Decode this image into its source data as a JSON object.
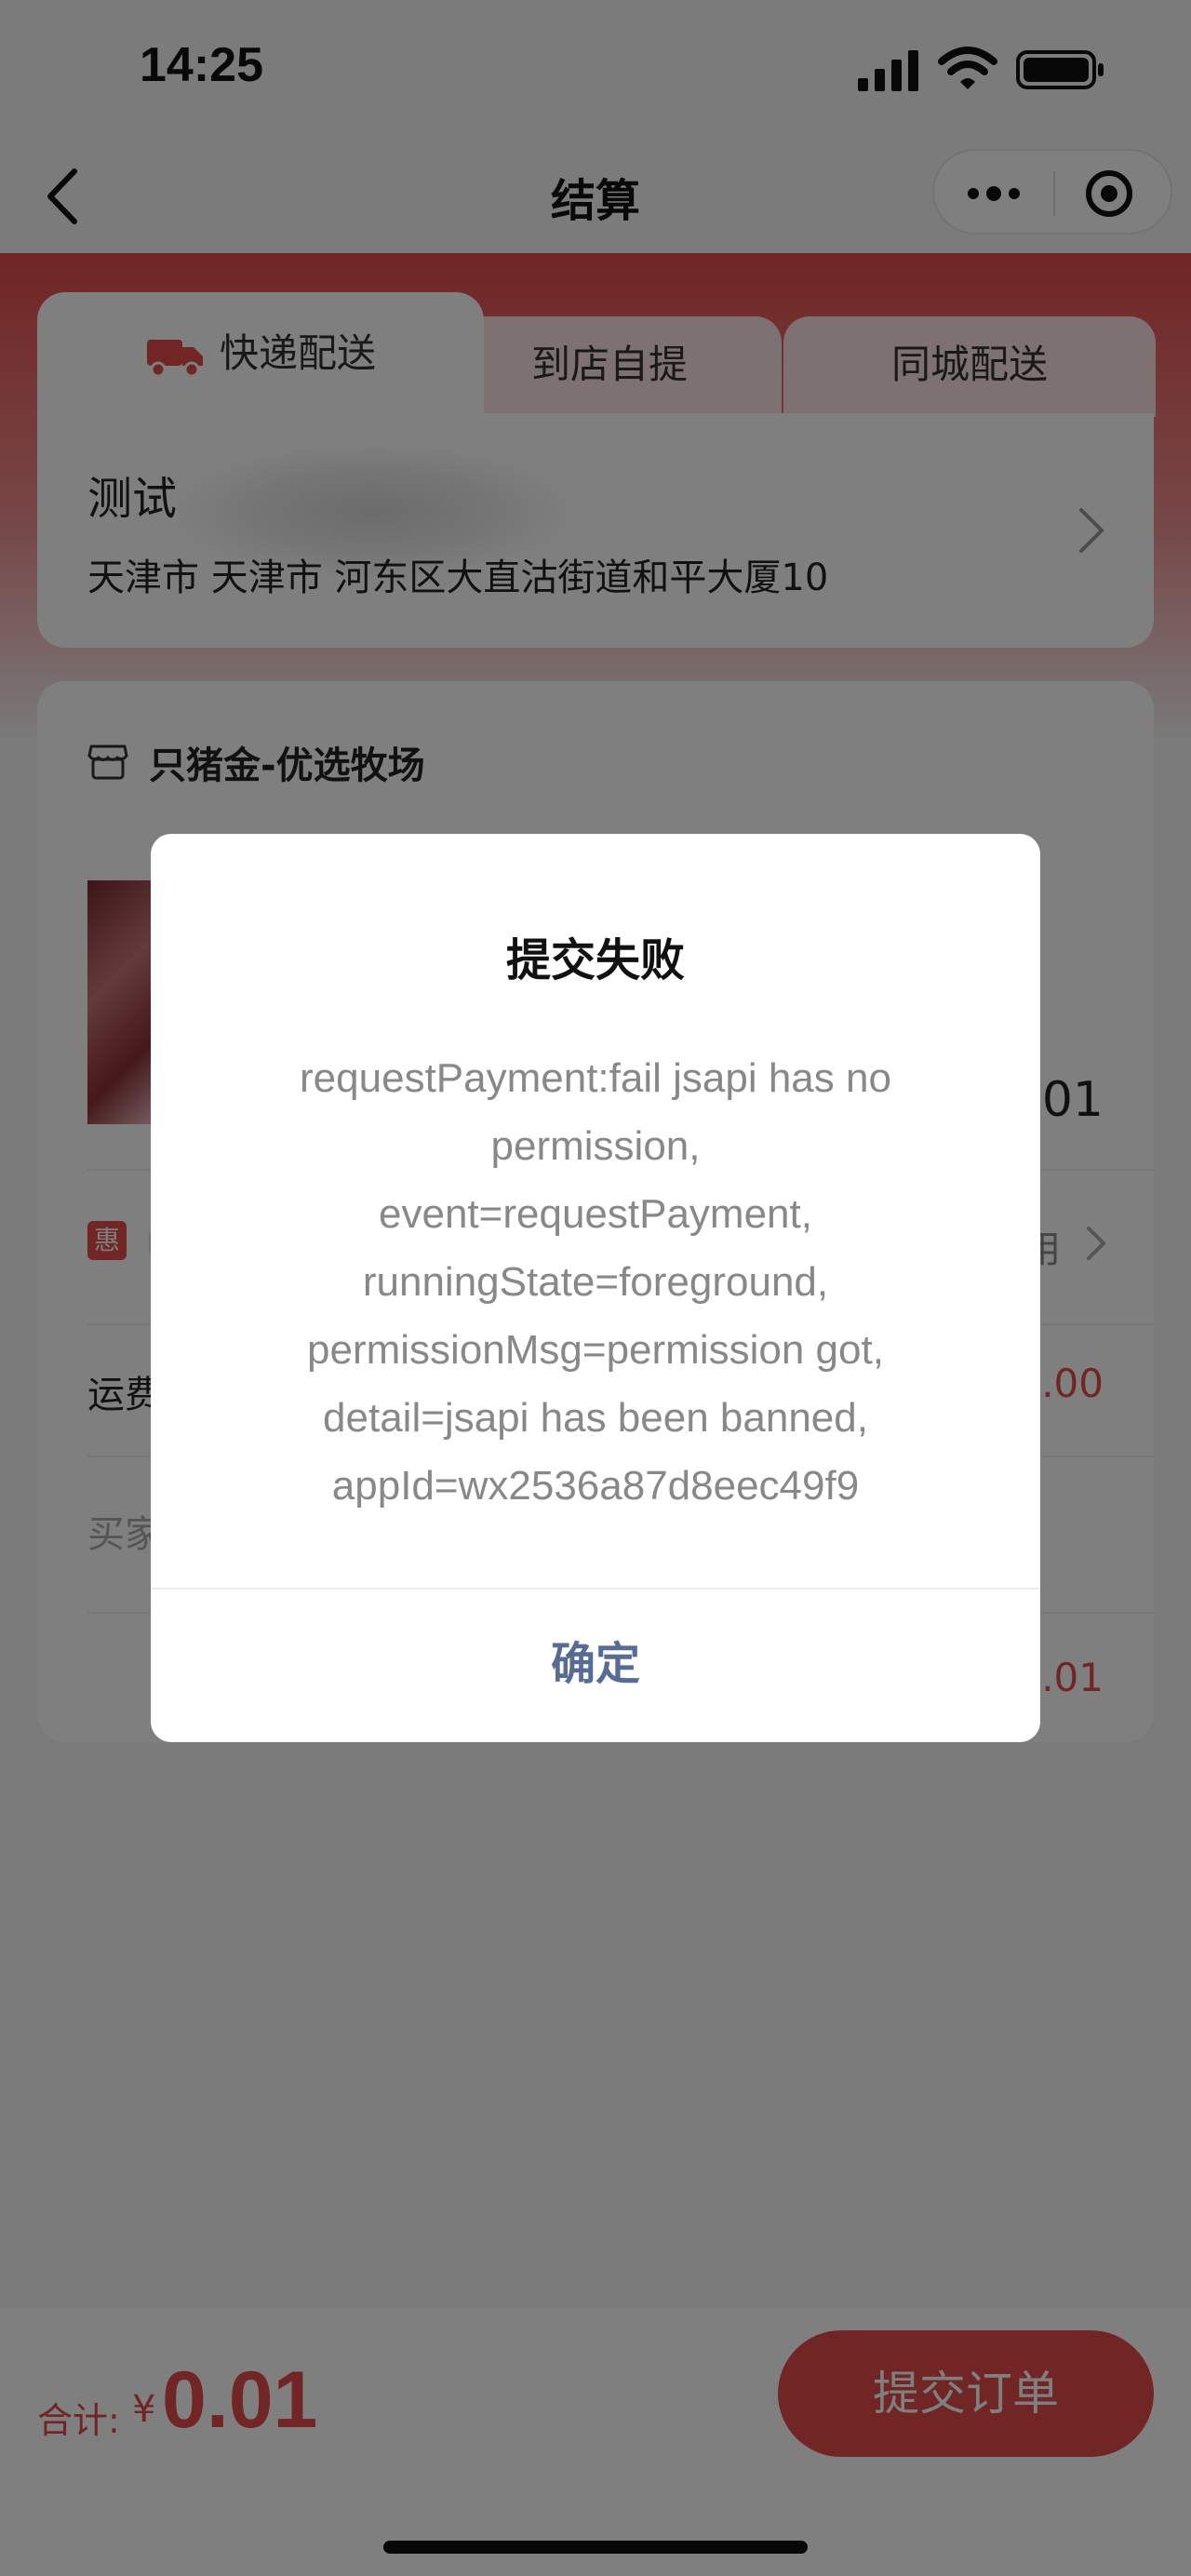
{
  "status_bar": {
    "time": "14:25"
  },
  "nav": {
    "title": "结算"
  },
  "delivery_tabs": [
    {
      "label": "快递配送"
    },
    {
      "label": "到店自提"
    },
    {
      "label": "同城配送"
    }
  ],
  "address": {
    "name": "测试",
    "detail": "天津市 天津市 河东区大直沽街道和平大厦10"
  },
  "store": {
    "name": "只猪金-优选牧场",
    "product_price": ".01",
    "coupon_badge": "惠",
    "coupon_value": "用",
    "shipping_label": "运费",
    "shipping_value": ".00",
    "buyer_label": "买家",
    "subtotal_value": "0.01"
  },
  "modal": {
    "title": "提交失败",
    "message_lines": [
      "requestPayment:fail jsapi has no",
      "permission,",
      "event=requestPayment,",
      "runningState=foreground,",
      "permissionMsg=permission got,",
      "detail=jsapi has been banned,",
      "appId=wx2536a87d8eec49f9"
    ],
    "confirm_label": "确定"
  },
  "bottom_bar": {
    "total_label": "合计:",
    "currency": "¥",
    "total_value": "0.01",
    "submit_label": "提交订单"
  },
  "colors": {
    "accent_red": "#e34b4b",
    "confirm_blue": "#576b95"
  }
}
